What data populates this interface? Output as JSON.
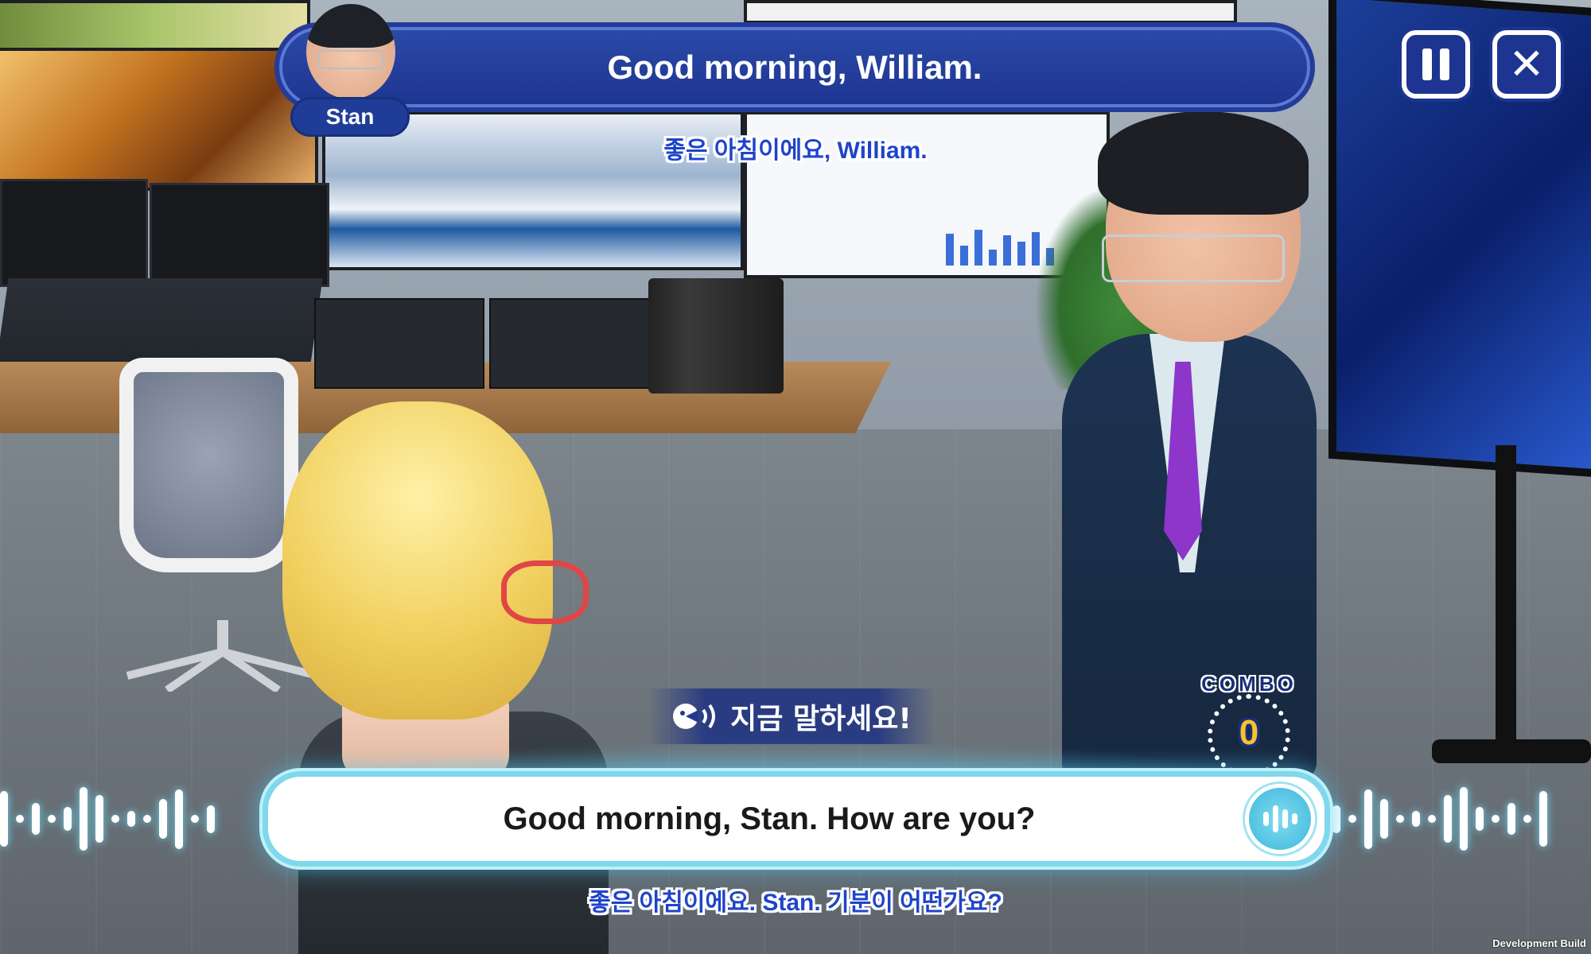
{
  "dialogue": {
    "speaker_name": "Stan",
    "line": "Good morning, William.",
    "line_translation": "좋은 아침이에요, William."
  },
  "controls": {
    "pause_icon": "pause-icon",
    "close_icon": "close-icon",
    "close_glyph": "✕"
  },
  "prompt": {
    "label": "지금 말하세요!",
    "icon": "speaking-head-icon"
  },
  "answer": {
    "text": "Good morning, Stan. How are you?",
    "translation": "좋은 아침이에요. Stan. 기분이 어떤가요?",
    "mic_icon": "voice-wave-icon"
  },
  "combo": {
    "label": "COMBO",
    "count": "0"
  },
  "footer": {
    "build_label": "Development Build"
  },
  "colors": {
    "banner": "#1d3590",
    "accent_cyan": "#7fd8ec",
    "subtitle_blue": "#1f44c9",
    "combo_gold": "#f4c52a"
  }
}
